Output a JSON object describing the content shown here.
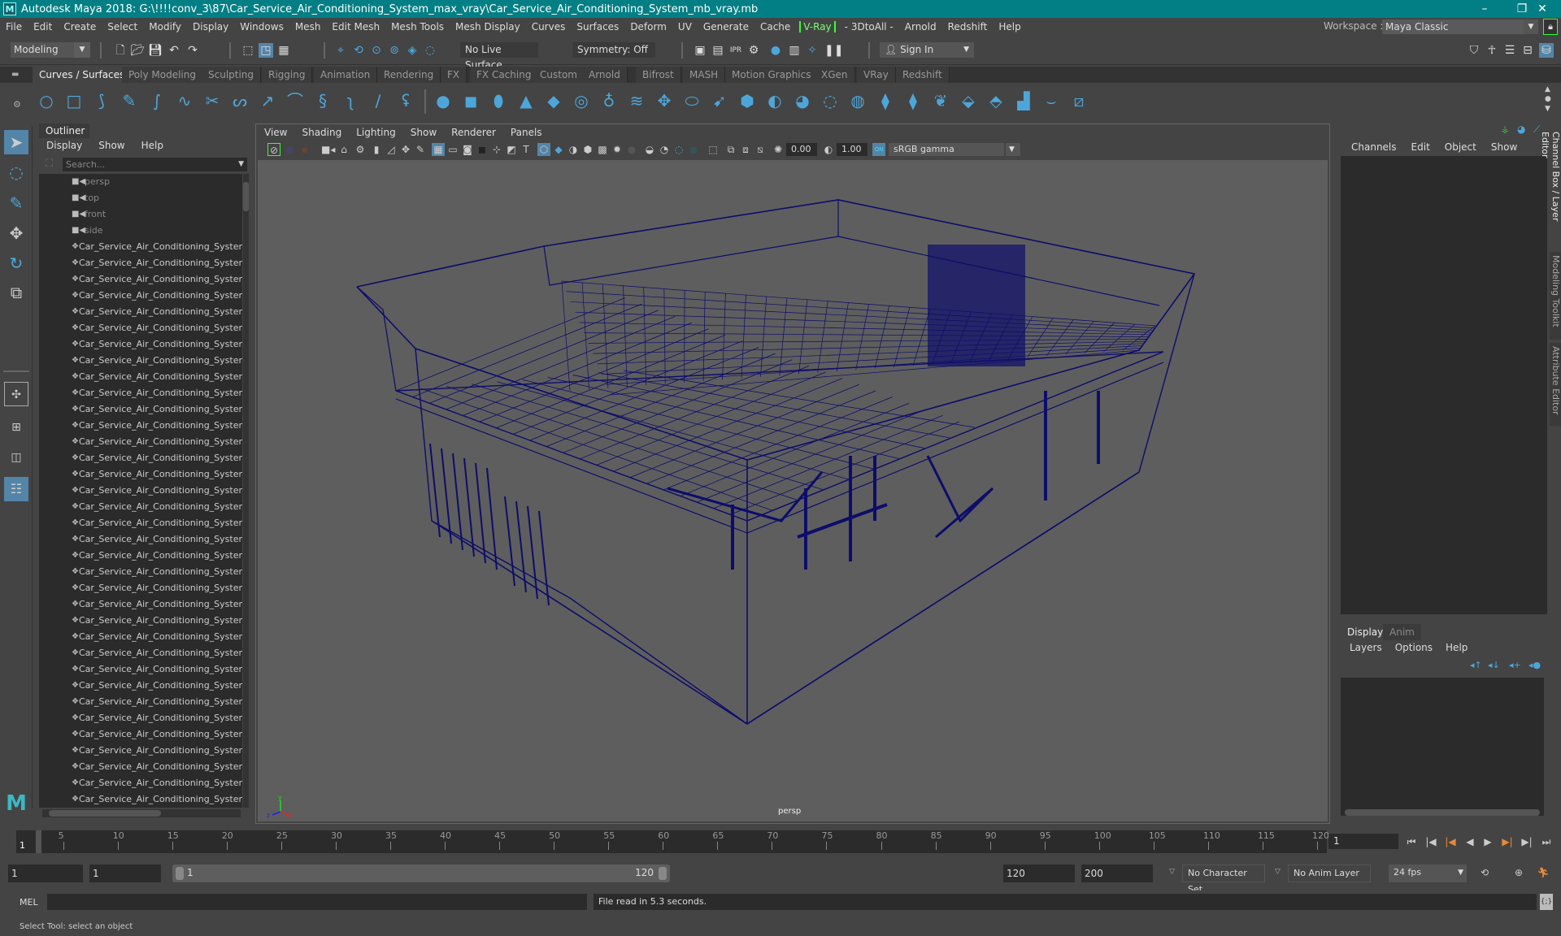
{
  "window": {
    "title": "Autodesk Maya 2018: G:\\!!!!conv_3\\87\\Car_Service_Air_Conditioning_System_max_vray\\Car_Service_Air_Conditioning_System_mb_vray.mb",
    "app_icon": "maya-logo-icon",
    "controls": {
      "minimize": "–",
      "maximize": "❐",
      "close": "✕"
    }
  },
  "menubar": {
    "items": [
      "File",
      "Edit",
      "Create",
      "Select",
      "Modify",
      "Display",
      "Windows",
      "Mesh",
      "Edit Mesh",
      "Mesh Tools",
      "Mesh Display",
      "Curves",
      "Surfaces",
      "Deform",
      "UV",
      "Generate",
      "Cache",
      "V-Ray",
      "- 3DtoAll -",
      "Arnold",
      "Redshift",
      "Help"
    ],
    "workspace_label": "Workspace :",
    "workspace_value": "Maya Classic"
  },
  "toolbar": {
    "mode": "Modeling",
    "live_surface": "No Live Surface",
    "symmetry": "Symmetry: Off",
    "sign_in": "Sign In"
  },
  "shelf": {
    "tabs": [
      "Curves / Surfaces",
      "Poly Modeling",
      "Sculpting",
      "Rigging",
      "Animation",
      "Rendering",
      "FX",
      "FX Caching",
      "Custom",
      "Arnold",
      "Bifrost",
      "MASH",
      "Motion Graphics",
      "XGen",
      "VRay",
      "Redshift"
    ],
    "active_tab": "Curves / Surfaces"
  },
  "outliner": {
    "title": "Outliner",
    "menu": [
      "Display",
      "Show",
      "Help"
    ],
    "search_placeholder": "Search...",
    "cameras": [
      "persp",
      "top",
      "front",
      "side"
    ],
    "object_name": "Car_Service_Air_Conditioning_System",
    "object_count_visible": 35
  },
  "viewport": {
    "menu": [
      "View",
      "Shading",
      "Lighting",
      "Show",
      "Renderer",
      "Panels"
    ],
    "exposure": "0.00",
    "gamma": "1.00",
    "color_space": "sRGB gamma",
    "camera_label": "persp",
    "axis": {
      "x": "x",
      "y": "y",
      "z": "z"
    },
    "wire_color": "#0d0d6b",
    "bg_color": "#5e5e5e"
  },
  "channel_box": {
    "menu": [
      "Channels",
      "Edit",
      "Object",
      "Show"
    ],
    "side_tabs": [
      "Channel Box / Layer Editor",
      "Modeling Toolkit",
      "Attribute Editor"
    ]
  },
  "layer_editor": {
    "tabs": [
      "Display",
      "Anim"
    ],
    "active_tab": "Display",
    "menu": [
      "Layers",
      "Options",
      "Help"
    ]
  },
  "timeline": {
    "ticks": [
      5,
      10,
      15,
      20,
      25,
      30,
      35,
      40,
      45,
      50,
      55,
      60,
      65,
      70,
      75,
      80,
      85,
      90,
      95,
      100,
      105,
      110,
      115,
      120
    ],
    "current_frame": "1",
    "current_frame_field": "1"
  },
  "range": {
    "start": "1",
    "start_anim": "1",
    "range_start": "1",
    "range_end": "120",
    "end": "120",
    "end_anim": "200",
    "character_set": "No Character Set",
    "anim_layer": "No Anim Layer",
    "fps": "24 fps"
  },
  "command_line": {
    "label": "MEL",
    "output": "File read in  5.3 seconds."
  },
  "help_line": "Select Tool: select an object"
}
